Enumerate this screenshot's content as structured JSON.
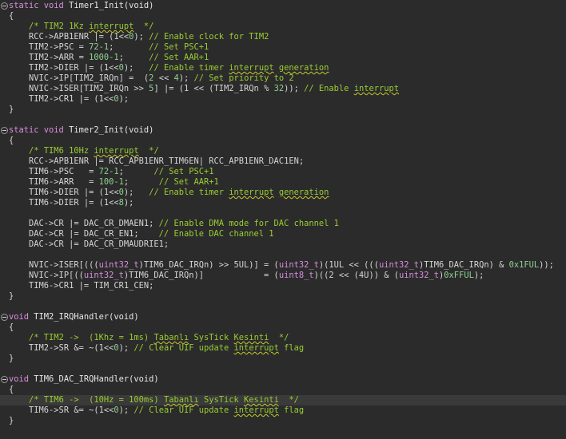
{
  "lines": [
    {
      "fold": true,
      "t": [
        [
          "kw",
          "static void "
        ],
        [
          "fn",
          "Timer1_Init(void)"
        ]
      ]
    },
    {
      "t": [
        [
          "p",
          "{"
        ]
      ]
    },
    {
      "t": [
        [
          "p",
          "    "
        ],
        [
          "cm",
          "/* TIM2 1Kz "
        ],
        [
          "cmb",
          "interrupt"
        ],
        [
          "cm",
          "  */"
        ]
      ]
    },
    {
      "t": [
        [
          "p",
          "    RCC->APB1ENR |= (1<<"
        ],
        [
          "num",
          "0"
        ],
        [
          "p",
          "); "
        ],
        [
          "cm",
          "// Enable clock for TIM2"
        ]
      ]
    },
    {
      "t": [
        [
          "p",
          "    TIM2->PSC = "
        ],
        [
          "num",
          "72-1"
        ],
        [
          "p",
          ";       "
        ],
        [
          "cm",
          "// Set PSC+1"
        ]
      ]
    },
    {
      "t": [
        [
          "p",
          "    TIM2->ARR = "
        ],
        [
          "num",
          "1000-1"
        ],
        [
          "p",
          ";     "
        ],
        [
          "cm",
          "// Set AAR+1"
        ]
      ]
    },
    {
      "t": [
        [
          "p",
          "    TIM2->DIER |= (1<<"
        ],
        [
          "num",
          "0"
        ],
        [
          "p",
          ");   "
        ],
        [
          "cm",
          "// Enable timer "
        ],
        [
          "cmb",
          "interrupt"
        ],
        [
          "cm",
          " "
        ],
        [
          "cmb",
          "generation"
        ]
      ]
    },
    {
      "t": [
        [
          "p",
          "    NVIC->IP[TIM2_IRQn] =  ("
        ],
        [
          "num",
          "2"
        ],
        [
          "p",
          " << "
        ],
        [
          "num",
          "4"
        ],
        [
          "p",
          "); "
        ],
        [
          "cm",
          "// Set priority to 2"
        ]
      ]
    },
    {
      "t": [
        [
          "p",
          "    NVIC->ISER[TIM2_IRQn >> "
        ],
        [
          "num",
          "5"
        ],
        [
          "p",
          "] |= (1 << (TIM2_IRQn % "
        ],
        [
          "num",
          "32"
        ],
        [
          "p",
          ")); "
        ],
        [
          "cm",
          "// Enable "
        ],
        [
          "cmb",
          "interrupt"
        ]
      ]
    },
    {
      "t": [
        [
          "p",
          "    TIM2->CR1 |= (1<<"
        ],
        [
          "num",
          "0"
        ],
        [
          "p",
          ");"
        ]
      ]
    },
    {
      "t": [
        [
          "p",
          "}"
        ]
      ]
    },
    {
      "t": []
    },
    {
      "fold": true,
      "t": [
        [
          "kw",
          "static void "
        ],
        [
          "fn",
          "Timer2_Init(void)"
        ]
      ]
    },
    {
      "t": [
        [
          "p",
          "{"
        ]
      ]
    },
    {
      "t": [
        [
          "p",
          "    "
        ],
        [
          "cm",
          "/* TIM6 10Hz "
        ],
        [
          "cmb",
          "interrupt"
        ],
        [
          "cm",
          "  */"
        ]
      ]
    },
    {
      "t": [
        [
          "p",
          "    RCC->APB1ENR |= RCC_APB1ENR_TIM6EN| RCC_APB1ENR_DAC1EN;"
        ]
      ]
    },
    {
      "t": [
        [
          "p",
          "    TIM6->PSC   = "
        ],
        [
          "num",
          "72-1"
        ],
        [
          "p",
          ";      "
        ],
        [
          "cm",
          "// Set PSC+1"
        ]
      ]
    },
    {
      "t": [
        [
          "p",
          "    TIM6->ARR   = "
        ],
        [
          "num",
          "100-1"
        ],
        [
          "p",
          ";      "
        ],
        [
          "cm",
          "// Set AAR+1"
        ]
      ]
    },
    {
      "t": [
        [
          "p",
          "    TIM6->DIER |= (1<<"
        ],
        [
          "num",
          "0"
        ],
        [
          "p",
          ");   "
        ],
        [
          "cm",
          "// Enable timer "
        ],
        [
          "cmb",
          "interrupt"
        ],
        [
          "cm",
          " "
        ],
        [
          "cmb",
          "generation"
        ]
      ]
    },
    {
      "t": [
        [
          "p",
          "    TIM6->DIER |= (1<<"
        ],
        [
          "num",
          "8"
        ],
        [
          "p",
          ");"
        ]
      ]
    },
    {
      "t": []
    },
    {
      "t": [
        [
          "p",
          "    DAC->CR |= DAC_CR_DMAEN1; "
        ],
        [
          "cm",
          "// Enable DMA mode for DAC channel 1"
        ]
      ]
    },
    {
      "t": [
        [
          "p",
          "    DAC->CR |= DAC_CR_EN1;    "
        ],
        [
          "cm",
          "// Enable DAC channel 1"
        ]
      ]
    },
    {
      "t": [
        [
          "p",
          "    DAC->CR |= DAC_CR_DMAUDRIE1;"
        ]
      ]
    },
    {
      "t": []
    },
    {
      "t": [
        [
          "p",
          "    NVIC->ISER[((("
        ],
        [
          "ty",
          "uint32_t"
        ],
        [
          "p",
          ")TIM6_DAC_IRQn) >> 5UL)] = ("
        ],
        [
          "ty",
          "uint32_t"
        ],
        [
          "p",
          ")(1UL << ((("
        ],
        [
          "ty",
          "uint32_t"
        ],
        [
          "p",
          ")TIM6_DAC_IRQn) & "
        ],
        [
          "num",
          "0x1FUL"
        ],
        [
          "p",
          "));"
        ]
      ]
    },
    {
      "t": [
        [
          "p",
          "    NVIC->IP[(("
        ],
        [
          "ty",
          "uint32_t"
        ],
        [
          "p",
          ")TIM6_DAC_IRQn)]            = ("
        ],
        [
          "ty",
          "uint8_t"
        ],
        [
          "p",
          ")((2 << (4U)) & ("
        ],
        [
          "ty",
          "uint32_t"
        ],
        [
          "p",
          ")"
        ],
        [
          "num",
          "0xFFUL"
        ],
        [
          "p",
          ");"
        ]
      ]
    },
    {
      "t": [
        [
          "p",
          "    TIM6->CR1 |= TIM_CR1_CEN;"
        ]
      ]
    },
    {
      "t": [
        [
          "p",
          "}"
        ]
      ]
    },
    {
      "t": []
    },
    {
      "fold": true,
      "t": [
        [
          "kw",
          "void "
        ],
        [
          "fn",
          "TIM2_IRQHandler(void)"
        ]
      ]
    },
    {
      "t": [
        [
          "p",
          "{"
        ]
      ]
    },
    {
      "t": [
        [
          "p",
          "    "
        ],
        [
          "cm",
          "/* TIM2 ->  (1Khz = 1ms) "
        ],
        [
          "cmb",
          "Tabanlı"
        ],
        [
          "cm",
          " SysTick "
        ],
        [
          "cmb",
          "Kesinti"
        ],
        [
          "cm",
          "  */"
        ]
      ]
    },
    {
      "t": [
        [
          "p",
          "    TIM2->SR &= ~(1<<"
        ],
        [
          "num",
          "0"
        ],
        [
          "p",
          "); "
        ],
        [
          "cm",
          "// Clear UIF update "
        ],
        [
          "cmb",
          "interrupt"
        ],
        [
          "cm",
          " flag"
        ]
      ]
    },
    {
      "t": [
        [
          "p",
          "}"
        ]
      ]
    },
    {
      "t": []
    },
    {
      "fold": true,
      "t": [
        [
          "kw",
          "void "
        ],
        [
          "fn",
          "TIM6_DAC_IRQHandler(void)"
        ]
      ]
    },
    {
      "t": [
        [
          "p",
          "{"
        ]
      ]
    },
    {
      "hl": true,
      "t": [
        [
          "p",
          "    "
        ],
        [
          "cm",
          "/* TIM6 ->  (10Hz = 100ms) "
        ],
        [
          "cmb",
          "Tabanlı"
        ],
        [
          "cm",
          " SysTick "
        ],
        [
          "cmb",
          "Kesinti"
        ],
        [
          "cm",
          "  */"
        ]
      ]
    },
    {
      "t": [
        [
          "p",
          "    TIM6->SR &= ~(1<<"
        ],
        [
          "num",
          "0"
        ],
        [
          "p",
          "); "
        ],
        [
          "cm",
          "// Clear UIF update "
        ],
        [
          "cmb",
          "interrupt"
        ],
        [
          "cm",
          " flag"
        ]
      ]
    },
    {
      "t": [
        [
          "p",
          "}"
        ]
      ]
    }
  ]
}
